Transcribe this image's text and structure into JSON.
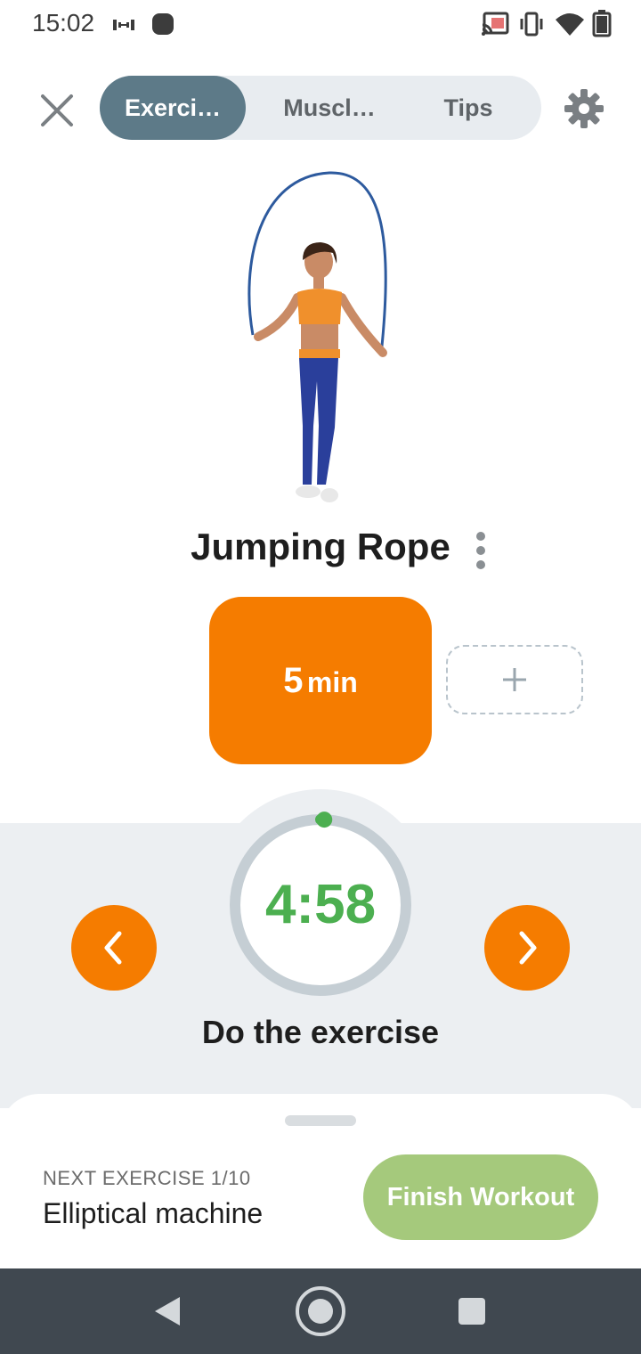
{
  "status_bar": {
    "time": "15:02",
    "left_icons": [
      "workout-app-icon",
      "notification-dot-icon"
    ],
    "right_icons": [
      "cast-icon",
      "vibrate-icon",
      "wifi-icon",
      "battery-icon"
    ]
  },
  "header": {
    "tabs": [
      {
        "label": "Exerci…",
        "active": true
      },
      {
        "label": "Muscl…",
        "active": false
      },
      {
        "label": "Tips",
        "active": false
      }
    ]
  },
  "exercise": {
    "name": "Jumping Rope",
    "duration_value": "5",
    "duration_unit": "min"
  },
  "timer": {
    "remaining": "4:58",
    "progress_fraction": 0.007,
    "label": "Do the exercise"
  },
  "next_exercise": {
    "label": "NEXT EXERCISE 1/10",
    "name": "Elliptical machine"
  },
  "actions": {
    "finish_label": "Finish Workout"
  },
  "colors": {
    "accent_orange": "#f57c00",
    "tab_active": "#5d7a88",
    "timer_green": "#4caf50",
    "finish_green": "#a5c97c",
    "ring_gray": "#c5ced4",
    "nav_bar": "#404850"
  }
}
